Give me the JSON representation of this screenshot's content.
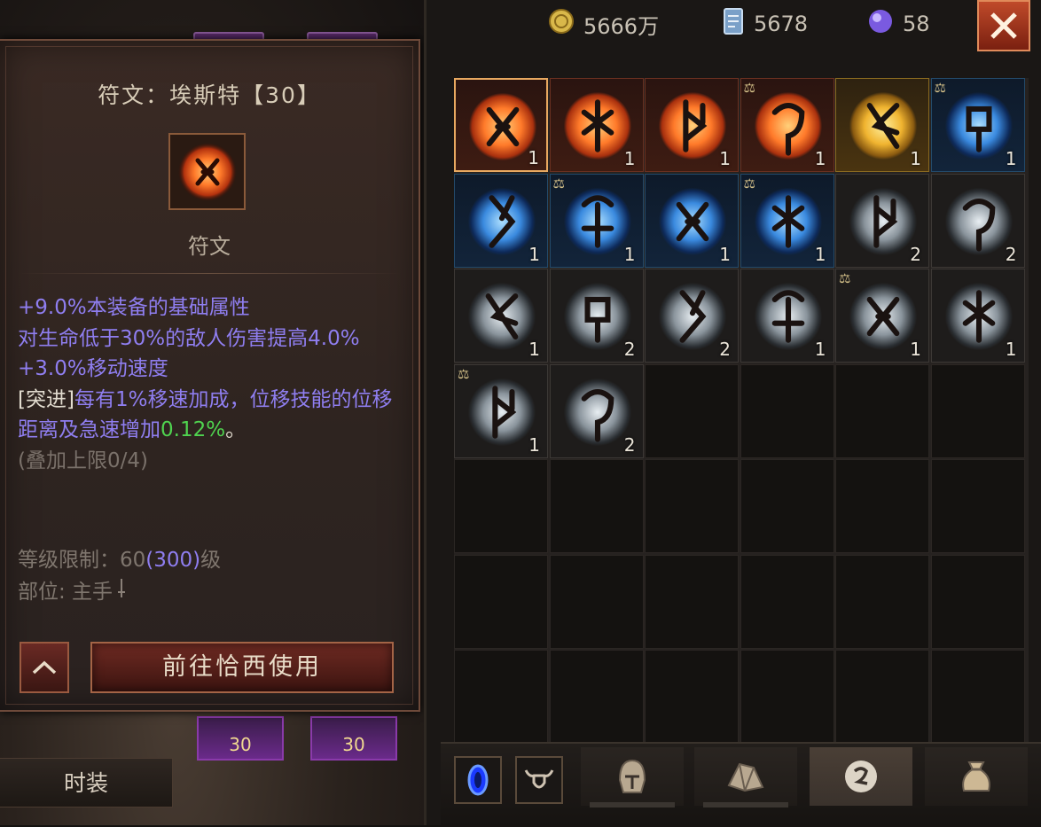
{
  "currencies": [
    {
      "icon": "gold-coin-icon",
      "value": "5666万"
    },
    {
      "icon": "scroll-card-icon",
      "value": "5678"
    },
    {
      "icon": "purple-orb-icon",
      "value": "58"
    }
  ],
  "tooltip": {
    "title": "符文：埃斯特【30】",
    "type": "符文",
    "stat1": "+9.0%本装备的基础属性",
    "stat2": "对生命低于30%的敌人伤害提高4.0%",
    "stat3": "+3.0%移动速度",
    "stat4_tag": "[突进]",
    "stat4_text": "每有1%移速加成，位移技能的位移距离及急速增加",
    "stat4_value": "0.12%",
    "stat4_end": "。",
    "stack_limit": "(叠加上限0/4)",
    "level_label": "等级限制：",
    "level_value": "60",
    "level_alt": "(300)",
    "level_unit": "级",
    "slot_label": "部位: 主手",
    "go_button": "前往恰西使用"
  },
  "left_panel": {
    "costume_button": "时装",
    "slot_levels": [
      "30",
      "30"
    ]
  },
  "inventory": [
    {
      "color": "orange",
      "count": "1",
      "locked": false,
      "selected": true
    },
    {
      "color": "orange",
      "count": "1",
      "locked": false
    },
    {
      "color": "orange",
      "count": "1",
      "locked": false
    },
    {
      "color": "orange",
      "count": "1",
      "locked": true
    },
    {
      "color": "gold",
      "count": "1",
      "locked": false
    },
    {
      "color": "blue",
      "count": "1",
      "locked": true
    },
    {
      "color": "blue",
      "count": "1",
      "locked": false
    },
    {
      "color": "blue",
      "count": "1",
      "locked": true
    },
    {
      "color": "blue",
      "count": "1",
      "locked": false
    },
    {
      "color": "blue",
      "count": "1",
      "locked": true
    },
    {
      "color": "grey",
      "count": "2",
      "locked": false
    },
    {
      "color": "grey",
      "count": "2",
      "locked": false
    },
    {
      "color": "grey",
      "count": "1",
      "locked": false
    },
    {
      "color": "grey",
      "count": "2",
      "locked": false
    },
    {
      "color": "grey",
      "count": "2",
      "locked": false
    },
    {
      "color": "grey",
      "count": "1",
      "locked": false
    },
    {
      "color": "grey",
      "count": "1",
      "locked": true
    },
    {
      "color": "grey",
      "count": "1",
      "locked": false
    },
    {
      "color": "grey",
      "count": "1",
      "locked": true
    },
    {
      "color": "grey",
      "count": "2",
      "locked": false
    }
  ],
  "bottom_tabs": [
    "helmet-tab",
    "gem-tab",
    "rune-tab",
    "bag-tab"
  ],
  "colors": {
    "accent_purple": "#8f7ef0",
    "accent_green": "#4fd34f",
    "button_red": "#6e2a22"
  }
}
